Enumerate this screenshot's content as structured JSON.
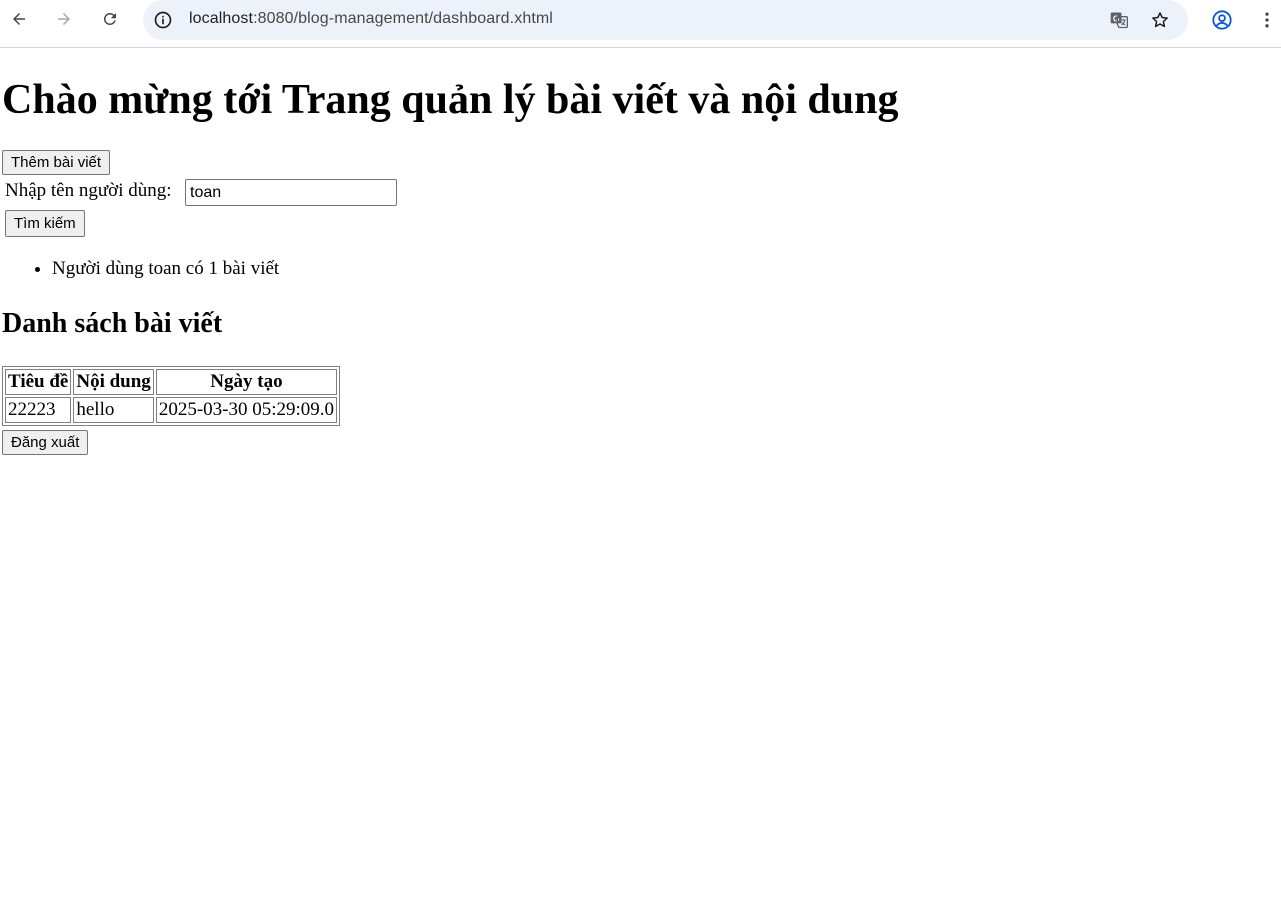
{
  "browser": {
    "url_host": "localhost",
    "url_rest": ":8080/blog-management/dashboard.xhtml",
    "icons": {
      "back": "arrow-left-icon",
      "forward": "arrow-right-icon",
      "reload": "reload-icon",
      "info": "info-icon",
      "translate": "translate-icon",
      "bookmark": "star-icon",
      "profile": "account-icon",
      "menu": "kebab-menu-icon"
    }
  },
  "page": {
    "title": "Chào mừng tới Trang quản lý bài viết và nội dung",
    "add_post_label": "Thêm bài viết",
    "user_label": "Nhập tên người dùng:",
    "user_value": "toan",
    "search_label": "Tìm kiếm",
    "results": [
      "Người dùng toan có 1 bài viết"
    ],
    "list_title": "Danh sách bài viết",
    "table": {
      "headers": [
        "Tiêu đề",
        "Nội dung",
        "Ngày tạo"
      ],
      "rows": [
        [
          "22223",
          "hello",
          "2025-03-30 05:29:09.0"
        ]
      ]
    },
    "logout_label": "Đăng xuất"
  }
}
